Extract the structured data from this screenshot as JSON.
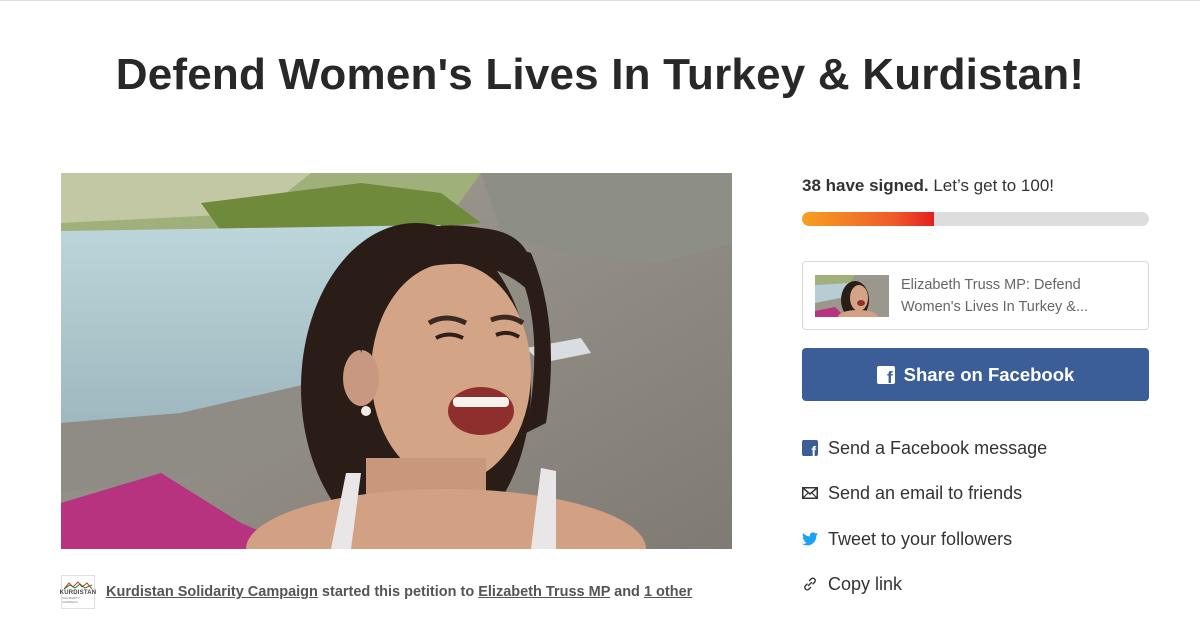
{
  "petition": {
    "title": "Defend Women's Lives In Turkey & Kurdistan!"
  },
  "starter": {
    "org_name": "Kurdistan Solidarity Campaign",
    "started_text": " started this petition to ",
    "target": "Elizabeth Truss MP",
    "and_text": " and ",
    "other": "1 other",
    "logo_word": "KURDISTAN",
    "logo_sub": "SOLIDARITY CAMPAIGN"
  },
  "progress": {
    "signed_bold": "38 have signed.",
    "goal_text": " Let’s get to 100!",
    "fraction": 0.38
  },
  "share_card": {
    "text": "Elizabeth Truss MP: Defend Women's Lives In Turkey &..."
  },
  "facebook_button": {
    "label": "Share on Facebook",
    "icon_glyph": "f"
  },
  "share_options": [
    {
      "label": "Send a Facebook message",
      "icon": "facebook-icon"
    },
    {
      "label": "Send an email to friends",
      "icon": "envelope-icon"
    },
    {
      "label": "Tweet to your followers",
      "icon": "twitter-bird-icon"
    },
    {
      "label": "Copy link",
      "icon": "link-icon"
    }
  ],
  "colors": {
    "facebook_blue": "#3b5e98",
    "twitter_blue": "#1da1f2",
    "progress_start": "#f7a021",
    "progress_end": "#e4201f",
    "progress_track": "#dddddd"
  }
}
